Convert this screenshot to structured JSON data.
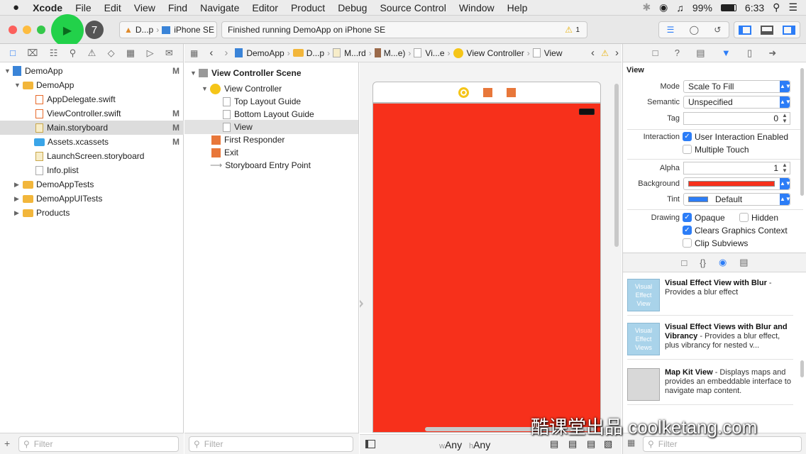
{
  "menubar": {
    "items": [
      "Xcode",
      "File",
      "Edit",
      "View",
      "Find",
      "Navigate",
      "Editor",
      "Product",
      "Debug",
      "Source Control",
      "Window",
      "Help"
    ],
    "battery": "99%",
    "time": "6:33"
  },
  "toolbar": {
    "badge": "7",
    "scheme": "D...p",
    "device": "iPhone SE",
    "status": "Finished running DemoApp on iPhone SE",
    "warnings": "1"
  },
  "navigator": {
    "items": [
      {
        "label": "DemoApp",
        "mark": "M"
      },
      {
        "label": "DemoApp",
        "mark": ""
      },
      {
        "label": "AppDelegate.swift",
        "mark": ""
      },
      {
        "label": "ViewController.swift",
        "mark": "M"
      },
      {
        "label": "Main.storyboard",
        "mark": "M"
      },
      {
        "label": "Assets.xcassets",
        "mark": "M"
      },
      {
        "label": "LaunchScreen.storyboard",
        "mark": ""
      },
      {
        "label": "Info.plist",
        "mark": ""
      },
      {
        "label": "DemoAppTests",
        "mark": ""
      },
      {
        "label": "DemoAppUITests",
        "mark": ""
      },
      {
        "label": "Products",
        "mark": ""
      }
    ],
    "filter_placeholder": "Filter"
  },
  "jumpbar": {
    "crumbs": [
      "DemoApp",
      "D...p",
      "M...rd",
      "M...e)",
      "Vi...e",
      "View Controller",
      "View"
    ]
  },
  "outline": {
    "scene": "View Controller Scene",
    "items": [
      "View Controller",
      "Top Layout Guide",
      "Bottom Layout Guide",
      "View",
      "First Responder",
      "Exit",
      "Storyboard Entry Point"
    ],
    "filter_placeholder": "Filter"
  },
  "canvas": {
    "background_color": "#f7301b",
    "size_class_w": "Any",
    "size_class_h": "Any",
    "w_prefix": "w",
    "h_prefix": "h"
  },
  "inspector": {
    "section": "View",
    "mode_label": "Mode",
    "mode_value": "Scale To Fill",
    "semantic_label": "Semantic",
    "semantic_value": "Unspecified",
    "tag_label": "Tag",
    "tag_value": "0",
    "interaction_label": "Interaction",
    "user_interaction": "User Interaction Enabled",
    "multiple_touch": "Multiple Touch",
    "alpha_label": "Alpha",
    "alpha_value": "1",
    "background_label": "Background",
    "tint_label": "Tint",
    "tint_value": "Default",
    "drawing_label": "Drawing",
    "opaque": "Opaque",
    "hidden": "Hidden",
    "clears": "Clears Graphics Context",
    "clip": "Clip Subviews"
  },
  "library": {
    "items": [
      {
        "thumb": "Visual Effect View",
        "title": "Visual Effect View with Blur",
        "desc": " - Provides a blur effect"
      },
      {
        "thumb": "Visual Effect Views",
        "title": "Visual Effect Views with Blur and Vibrancy",
        "desc": " - Provides a blur effect, plus vibrancy for nested v..."
      },
      {
        "thumb": "",
        "title": "Map Kit View",
        "desc": " - Displays maps and provides an embeddable interface to navigate map content."
      }
    ],
    "filter_placeholder": "Filter"
  },
  "watermark": "酷课堂出品 coolketang.com"
}
